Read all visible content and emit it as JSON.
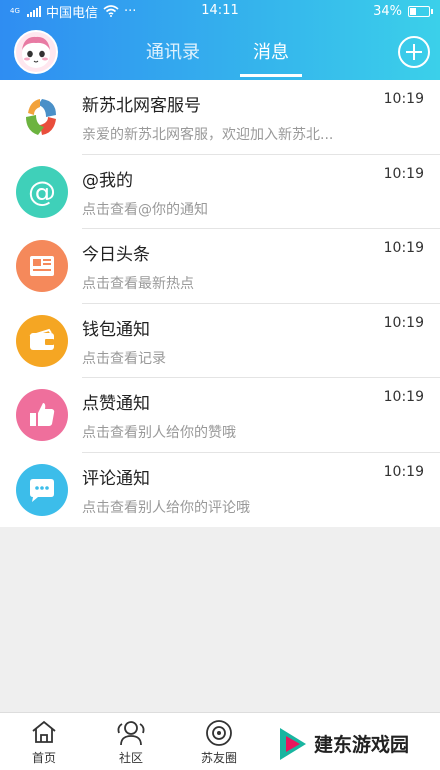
{
  "status_bar": {
    "signal_small": "4G",
    "carrier": "中国电信",
    "dots": "···",
    "time": "14:11",
    "battery": "34%",
    "battery_level": 0.34
  },
  "header": {
    "tabs": [
      "通讯录",
      "消息"
    ],
    "active_tab": "消息"
  },
  "messages": [
    {
      "icon": "xinsubei-logo-icon",
      "title": "新苏北网客服号",
      "preview": "亲爱的新苏北网客服，欢迎加入新苏北...",
      "time": "10:19"
    },
    {
      "icon": "at-icon",
      "title": "@我的",
      "preview": "点击查看@你的通知",
      "time": "10:19",
      "color": "#3fd0b9"
    },
    {
      "icon": "newspaper-icon",
      "title": "今日头条",
      "preview": "点击查看最新热点",
      "time": "10:19",
      "color": "#f5895b"
    },
    {
      "icon": "wallet-icon",
      "title": "钱包通知",
      "preview": "点击查看记录",
      "time": "10:19",
      "color": "#f5a623"
    },
    {
      "icon": "thumbs-up-icon",
      "title": "点赞通知",
      "preview": "点击查看别人给你的赞哦",
      "time": "10:19",
      "color": "#ef6f9c"
    },
    {
      "icon": "comment-icon",
      "title": "评论通知",
      "preview": "点击查看别人给你的评论哦",
      "time": "10:19",
      "color": "#3cbdea"
    }
  ],
  "tabbar": {
    "home": "首页",
    "community": "社区",
    "friends_circle": "苏友圈"
  },
  "watermark": "建东游戏园"
}
